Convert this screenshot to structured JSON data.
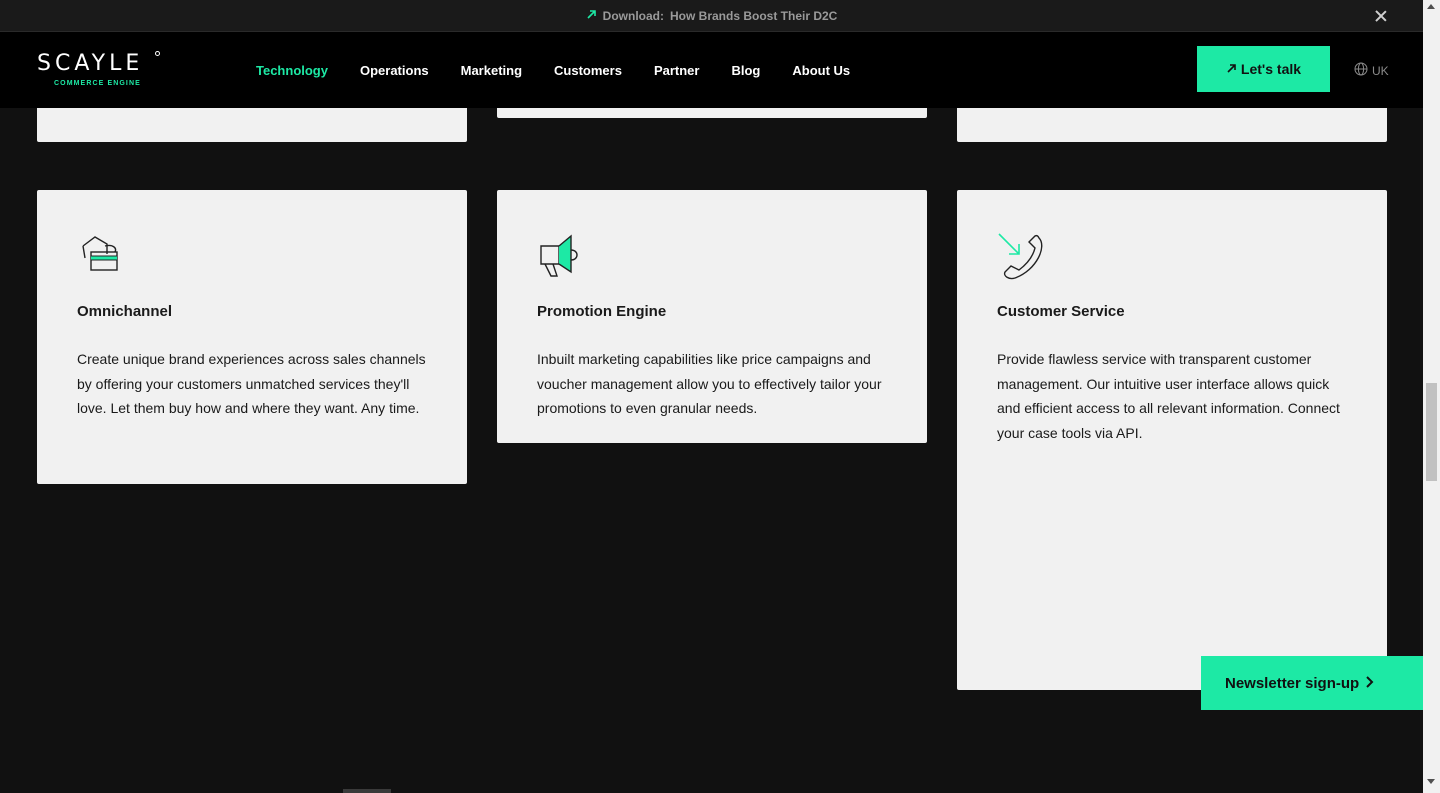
{
  "announcement": {
    "label": "Download:",
    "text": "How Brands Boost Their D2C"
  },
  "header": {
    "logo_word": "SCAYLE",
    "logo_sub": "COMMERCE ENGINE",
    "nav": [
      "Technology",
      "Operations",
      "Marketing",
      "Customers",
      "Partner",
      "Blog",
      "About Us"
    ],
    "active_nav": "Technology",
    "cta_label": "Let's talk",
    "lang_label": "UK"
  },
  "cards": [
    {
      "title": "Omnichannel",
      "icon": "omnichannel-icon",
      "description": "Create unique brand experiences across sales channels by offering your customers unmatched services they'll love. Let them buy how and where they want. Any time."
    },
    {
      "title": "Promotion Engine",
      "icon": "megaphone-icon",
      "description": "Inbuilt marketing capabilities like price campaigns and voucher management allow you to effectively tailor your promotions to even granular needs."
    },
    {
      "title": "Customer Service",
      "icon": "phone-icon",
      "description": "Provide flawless service with transparent customer management. Our intuitive user interface allows quick and efficient access to all relevant information. Connect your case tools via API."
    }
  ],
  "newsletter": {
    "label": "Newsletter sign-up"
  },
  "colors": {
    "accent": "#1de9a5",
    "background": "#111111",
    "card": "#f1f1f1"
  }
}
